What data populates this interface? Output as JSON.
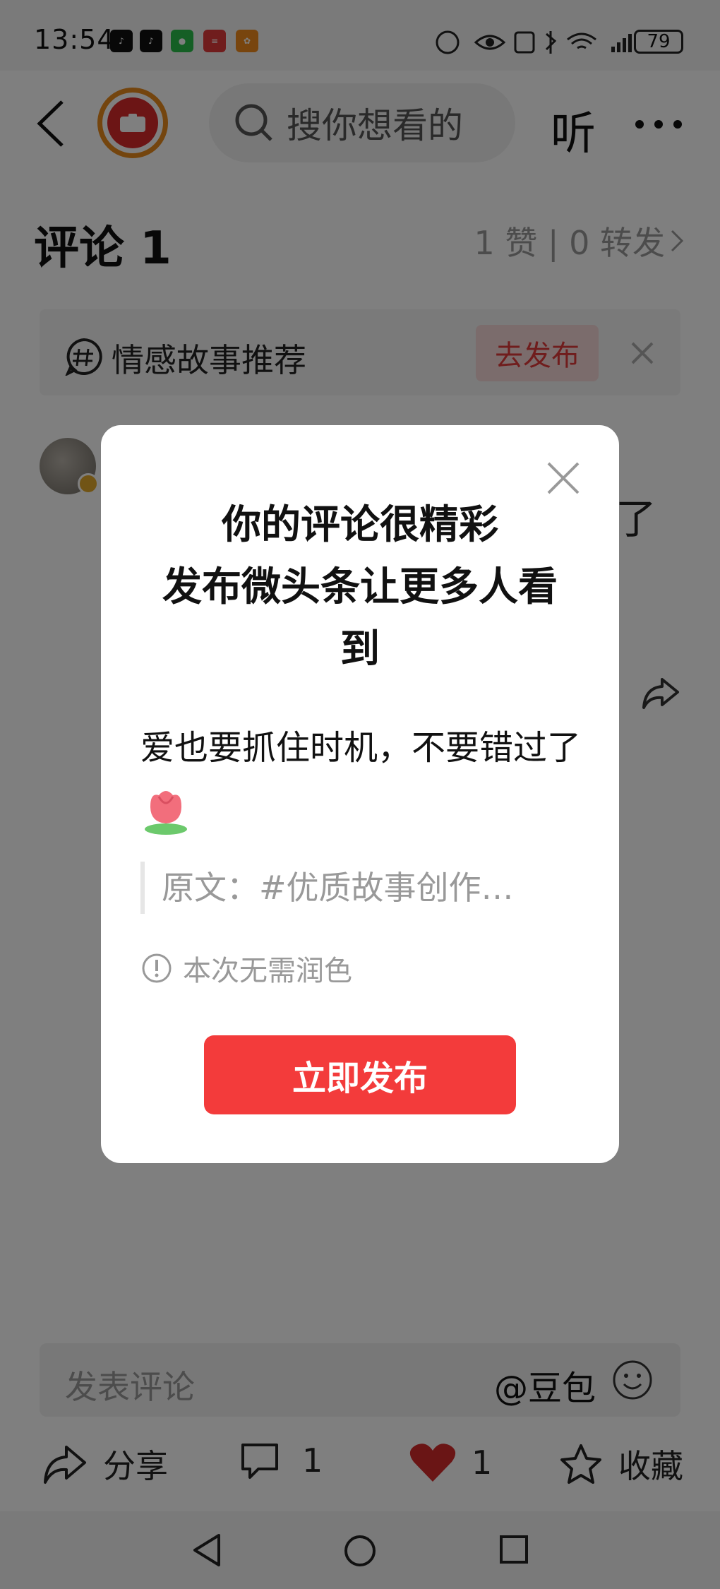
{
  "status_bar": {
    "time": "13:54",
    "battery": "79"
  },
  "header": {
    "search_placeholder": "搜你想看的",
    "listen_label": "听"
  },
  "comments": {
    "title": "评论 1",
    "stats": "1 赞 | 0 转发"
  },
  "topic_banner": {
    "label": "情感故事推荐",
    "publish_label": "去发布"
  },
  "background_comment": {
    "visible_text": "了"
  },
  "bottom": {
    "input_placeholder": "发表评论",
    "mention_label": "@豆包",
    "share_label": "分享",
    "comment_count": "1",
    "like_count": "1",
    "favorite_label": "收藏"
  },
  "modal": {
    "title_line1": "你的评论很精彩",
    "title_line2": "发布微头条让更多人看到",
    "comment_text": "爱也要抓住时机，不要错过了",
    "original_text": "原文：#优质故事创作…",
    "note": "本次无需润色",
    "publish_button": "立即发布"
  },
  "colors": {
    "accent_red": "#f33b3b",
    "like_red": "#d42a2a",
    "logo_orange": "#e98a1d"
  }
}
